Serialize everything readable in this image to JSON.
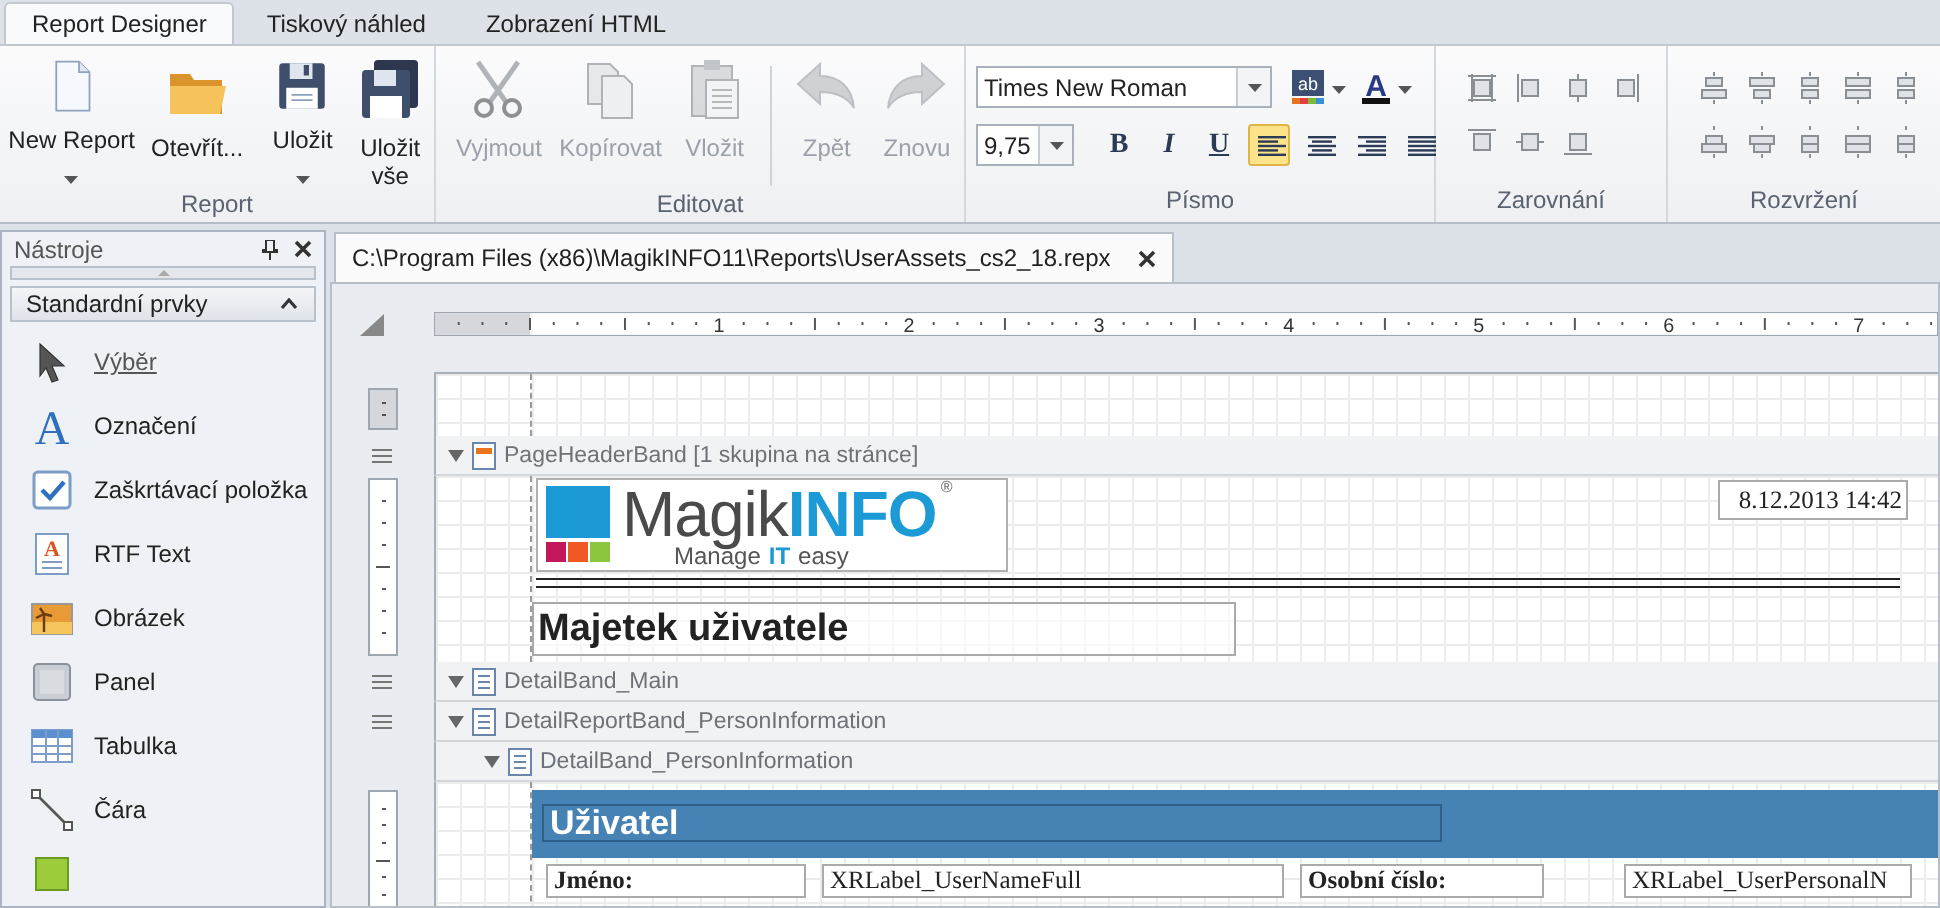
{
  "tabs": [
    {
      "label": "Report Designer",
      "selected": true
    },
    {
      "label": "Tiskový náhled",
      "selected": false
    },
    {
      "label": "Zobrazení HTML",
      "selected": false
    }
  ],
  "ribbon": {
    "report": {
      "label": "Report",
      "buttons": [
        {
          "kind": "new",
          "label": "New Report",
          "dropdown": true,
          "disabled": false
        },
        {
          "kind": "open",
          "label": "Otevřít...",
          "dropdown": false,
          "disabled": false
        },
        {
          "kind": "save",
          "label": "Uložit",
          "dropdown": true,
          "disabled": false
        },
        {
          "kind": "save-all",
          "label": "Uložit vše",
          "dropdown": false,
          "disabled": false
        }
      ]
    },
    "edit": {
      "label": "Editovat",
      "buttons": [
        {
          "kind": "cut",
          "label": "Vyjmout",
          "dropdown": false,
          "disabled": true
        },
        {
          "kind": "copy",
          "label": "Kopírovat",
          "dropdown": false,
          "disabled": true
        },
        {
          "kind": "paste",
          "label": "Vložit",
          "dropdown": false,
          "disabled": true
        },
        {
          "kind": "undo",
          "label": "Zpět",
          "dropdown": false,
          "disabled": true
        },
        {
          "kind": "redo",
          "label": "Znovu",
          "dropdown": false,
          "disabled": true
        }
      ]
    },
    "font": {
      "label": "Písmo",
      "font_name": "Times New Roman",
      "font_size": "9,75",
      "highlight_glyph": "ab",
      "color_glyph": "A",
      "styles": [
        {
          "kind": "bold",
          "label": "B"
        },
        {
          "kind": "italic",
          "label": "I"
        },
        {
          "kind": "underline",
          "label": "U"
        }
      ],
      "alignments": [
        {
          "kind": "left",
          "selected": true
        },
        {
          "kind": "center",
          "selected": false
        },
        {
          "kind": "right",
          "selected": false
        },
        {
          "kind": "justify",
          "selected": false
        }
      ]
    },
    "align": {
      "label": "Zarovnání"
    },
    "layout": {
      "label": "Rozvržení"
    }
  },
  "toolbox": {
    "title": "Nástroje",
    "group": {
      "label": "Standardní prvky",
      "expanded": true,
      "items": [
        {
          "kind": "pointer",
          "label": "Výběr",
          "selected": true
        },
        {
          "kind": "label",
          "glyph": "A",
          "label": "Označení",
          "selected": false
        },
        {
          "kind": "checkbox",
          "label": "Zaškrtávací položka",
          "selected": false
        },
        {
          "kind": "rtf",
          "glyph": "A",
          "label": "RTF Text",
          "selected": false
        },
        {
          "kind": "picture",
          "label": "Obrázek",
          "selected": false
        },
        {
          "kind": "panel",
          "label": "Panel",
          "selected": false
        },
        {
          "kind": "table",
          "label": "Tabulka",
          "selected": false
        },
        {
          "kind": "line",
          "label": "Čára",
          "selected": false
        },
        {
          "kind": "shape",
          "selected": false
        }
      ]
    }
  },
  "document": {
    "tab": "C:\\Program Files (x86)\\MagikINFO11\\Reports\\UserAssets_cs2_18.repx",
    "ruler_labels": [
      "1",
      "2",
      "3",
      "4",
      "5",
      "6",
      "7"
    ],
    "page_header": {
      "caption": "PageHeaderBand [1 skupina na stránce]",
      "expanded": true,
      "logo": {
        "word_1": "Magik",
        "word_2": "INFO",
        "mark": "®",
        "tagline": [
          "Manage",
          "IT",
          "easy"
        ]
      },
      "date": "8.12.2013 14:42",
      "title": "Majetek uživatele"
    },
    "detail_main": {
      "caption": "DetailBand_Main",
      "expanded": true
    },
    "detail_report": {
      "caption": "DetailReportBand_PersonInformation",
      "expanded": true,
      "children": [
        {
          "caption": "DetailBand_PersonInformation",
          "expanded": true,
          "section_title": "Uživatel",
          "fields": [
            {
              "kind": "label",
              "text": "Jméno:"
            },
            {
              "kind": "value",
              "text": "XRLabel_UserNameFull"
            },
            {
              "kind": "label",
              "text": "Osobní číslo:"
            },
            {
              "kind": "value",
              "text": "XRLabel_UserPersonalN"
            }
          ]
        }
      ]
    }
  }
}
